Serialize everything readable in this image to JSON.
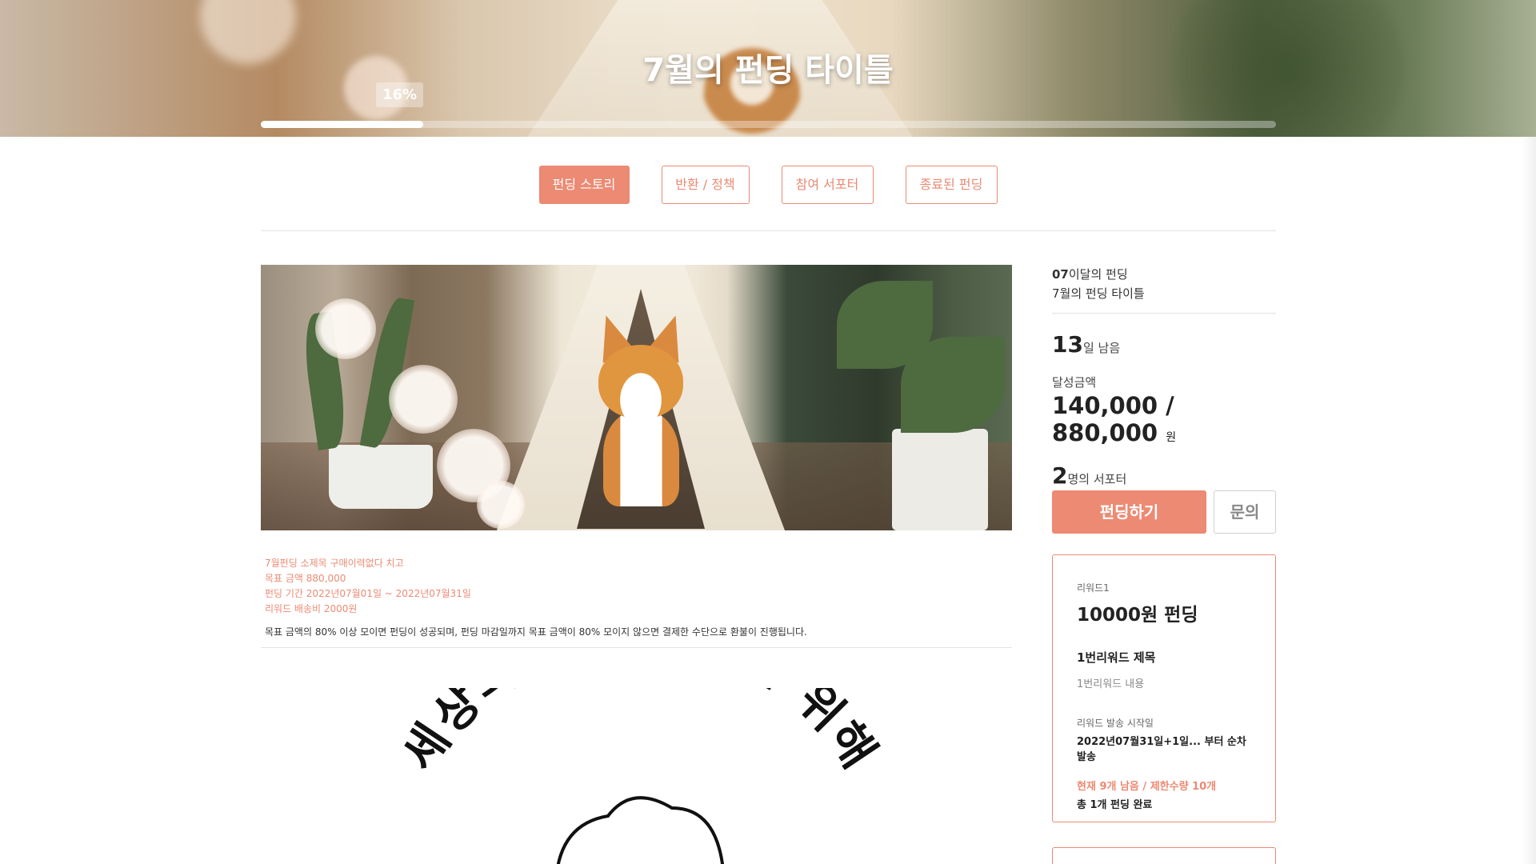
{
  "hero": {
    "title": "7월의 펀딩 타이틀",
    "progress_label": "16%",
    "progress": 0.16
  },
  "tabs": [
    {
      "label": "펀딩 스토리",
      "active": true
    },
    {
      "label": "반환 / 정책",
      "active": false
    },
    {
      "label": "참여 서포터",
      "active": false
    },
    {
      "label": "종료된 펀딩",
      "active": false
    }
  ],
  "description": {
    "lines": [
      "7월펀딩 소제목 구매이력없다 치고",
      "목표 금액 880,000",
      "펀딩 기간 2022년07월01일 ~ 2022년07월31일",
      "리워드 배송비 2000원"
    ],
    "note": "목표 금액의 80% 이상 모이면 펀딩이 성공되며, 펀딩 마감일까지 목표 금액이 80% 모이지 않으면 결제한 수단으로 환불이 진행됩니다."
  },
  "story_graphic": {
    "curved_text": "세상의 모든 뚜뚜를 위해"
  },
  "sidebar": {
    "month_number": "07",
    "month_suffix": "이달의 펀딩",
    "title": "7월의 펀딩 타이틀",
    "days_left": "13",
    "days_left_suffix": "일 남음",
    "raised_label": "달성금액",
    "raised_amount": "140,000 / 880,000",
    "currency": "원",
    "supporters": "2",
    "supporters_suffix": "명의 서포터",
    "fund_button": "펀딩하기",
    "ask_button": "문의"
  },
  "reward": {
    "label": "리워드1",
    "price": "10000원 펀딩",
    "title": "1번리워드 제목",
    "content": "1번리워드 내용",
    "ship_label": "리워드 발송 시작일",
    "ship_date": "2022년07월31일+1일... 부터 순차발송",
    "remaining": "현재 9개 남음 / 제한수량 10개",
    "done": "총 1개 펀딩 완료"
  },
  "colors": {
    "accent": "#ec8a73",
    "border": "#e3e3e3"
  }
}
